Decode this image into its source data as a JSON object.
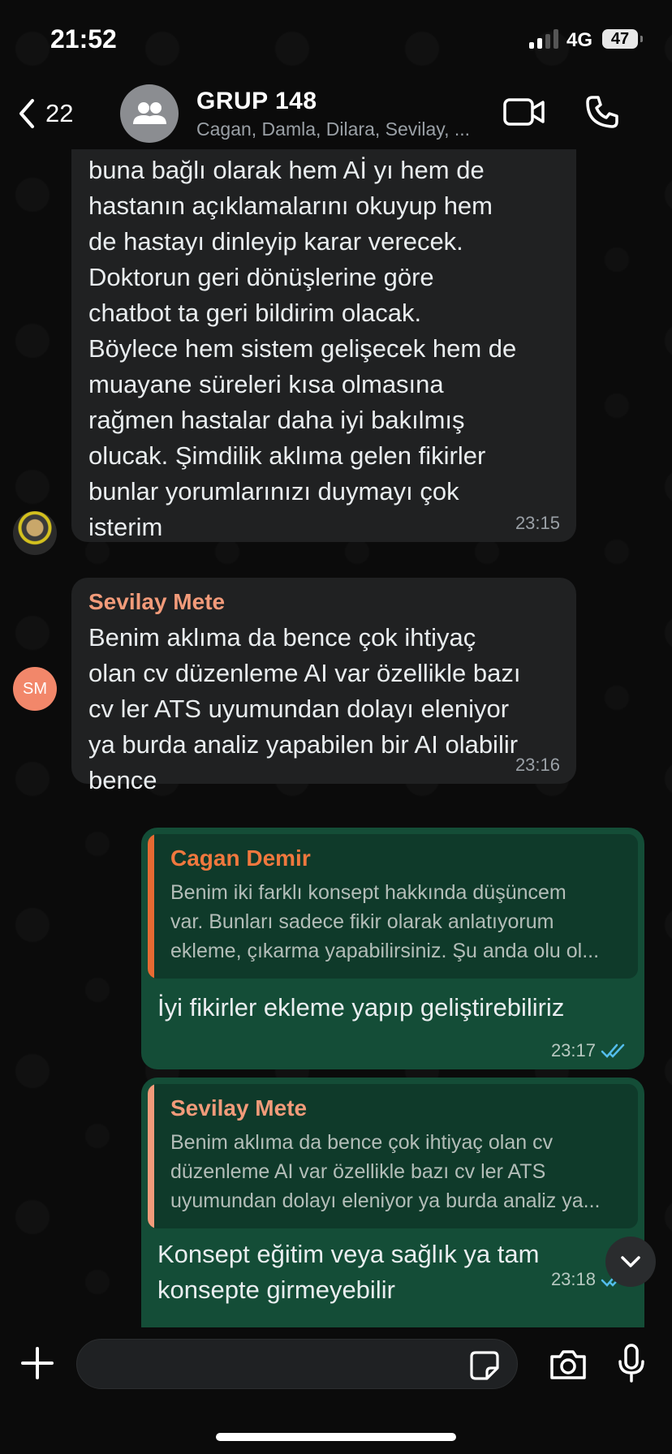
{
  "status": {
    "time": "21:52",
    "network": "4G",
    "battery": "47"
  },
  "header": {
    "back_count": "22",
    "title": "GRUP 148",
    "subtitle": "Cagan, Damla, Dilara, Sevilay, ..."
  },
  "messages": [
    {
      "lines": [
        "buna bağlı olarak hem Aİ yı hem de",
        "hastanın açıklamalarını okuyup hem",
        "de hastayı dinleyip karar verecek.",
        "Doktorun geri dönüşlerine göre",
        "chatbot ta geri bildirim olacak.",
        "Böylece hem sistem gelişecek hem de",
        "muayane süreleri kısa olmasına",
        "rağmen hastalar daha iyi bakılmış",
        "olucak. Şimdilik aklıma gelen fikirler",
        "bunlar yorumlarınızı duymayı çok",
        "isterim"
      ],
      "time": "23:15"
    },
    {
      "sender": "Sevilay Mete",
      "avatar_initials": "SM",
      "lines": [
        "Benim aklıma da bence çok ihtiyaç",
        "olan cv düzenleme AI var özellikle bazı",
        "cv ler ATS uyumundan dolayı eleniyor",
        "ya burda analiz yapabilen bir AI olabilir",
        "bence"
      ],
      "time": "23:16"
    },
    {
      "quote_name": "Cagan Demir",
      "quote_lines": [
        "Benim iki farklı konsept hakkında düşüncem",
        "var. Bunları sadece fikir olarak anlatıyorum",
        "ekleme, çıkarma yapabilirsiniz. Şu anda olu ol..."
      ],
      "text": "İyi fikirler ekleme yapıp geliştirebiliriz",
      "time": "23:17"
    },
    {
      "quote_name": "Sevilay Mete",
      "quote_lines": [
        "Benim aklıma da bence çok ihtiyaç olan cv",
        "düzenleme AI var özellikle bazı cv ler ATS",
        "uyumundan dolayı eleniyor ya burda analiz ya..."
      ],
      "lines": [
        "Konsept eğitim veya sağlık ya tam",
        "konsepte girmeyebilir"
      ],
      "time": "23:18"
    }
  ],
  "icons": [
    "back-chevron-icon",
    "group-icon",
    "video-call-icon",
    "phone-icon",
    "chevron-down-icon",
    "plus-icon",
    "sticker-icon",
    "camera-icon",
    "microphone-icon"
  ],
  "colors": {
    "outgoing": "#144d37",
    "incoming": "#202122",
    "sender": "#f29b7a",
    "read_tick": "#53bdeb"
  }
}
